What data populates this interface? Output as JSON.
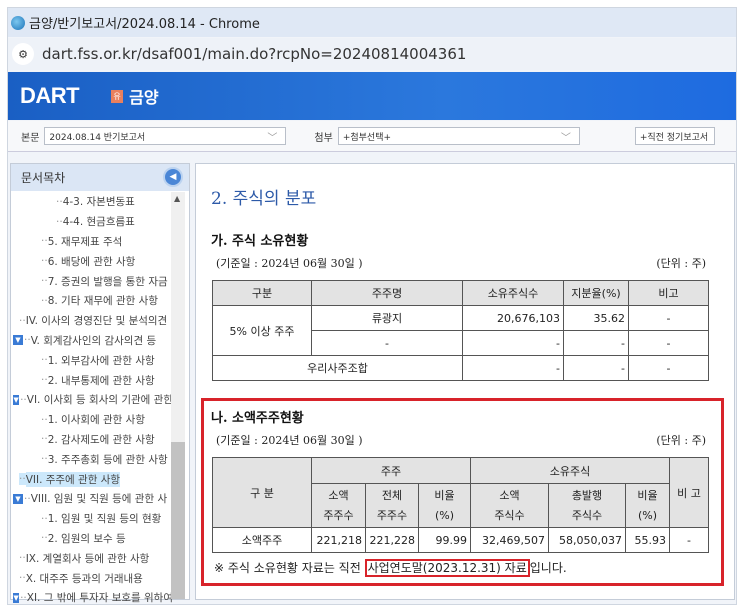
{
  "window": {
    "title": "금양/반기보고서/2024.08.14 - Chrome",
    "url": "dart.fss.or.kr/dsaf001/main.do?rcpNo=20240814004361"
  },
  "header": {
    "brand": "DART",
    "company_badge": "유",
    "company": "금양"
  },
  "selectors": {
    "main_label": "본문",
    "main_value": "2024.08.14  반기보고서",
    "attach_label": "첨부",
    "attach_value": "+첨부선택+",
    "prev_value": "+직전 정기보고서"
  },
  "sidebar": {
    "title": "문서목차",
    "items": [
      {
        "label": "4-3. 자본변동표",
        "indent": 3
      },
      {
        "label": "4-4. 현금흐름표",
        "indent": 3
      },
      {
        "label": "5. 재무제표 주석",
        "indent": 2
      },
      {
        "label": "6. 배당에 관한 사항",
        "indent": 2
      },
      {
        "label": "7. 증권의 발행을 통한 자금",
        "indent": 2
      },
      {
        "label": "8. 기타 재무에 관한 사항",
        "indent": 2
      },
      {
        "label": "IV. 이사의 경영진단 및 분석의견",
        "indent": 1
      },
      {
        "label": "V. 회계감사인의 감사의견 등",
        "indent": 0,
        "expand": true
      },
      {
        "label": "1. 외부감사에 관한 사항",
        "indent": 2
      },
      {
        "label": "2. 내부통제에 관한 사항",
        "indent": 2
      },
      {
        "label": "VI. 이사회 등 회사의 기관에 관한",
        "indent": 0,
        "expand": true
      },
      {
        "label": "1. 이사회에 관한 사항",
        "indent": 2
      },
      {
        "label": "2. 감사제도에 관한 사항",
        "indent": 2
      },
      {
        "label": "3. 주주총회 등에 관한 사항",
        "indent": 2
      },
      {
        "label": "VII. 주주에 관한 사항",
        "indent": 1,
        "selected": true
      },
      {
        "label": "VIII. 임원 및 직원 등에 관한 사",
        "indent": 0,
        "expand": true
      },
      {
        "label": "1. 임원 및 직원 등의 현황",
        "indent": 2
      },
      {
        "label": "2. 임원의 보수 등",
        "indent": 2
      },
      {
        "label": "IX. 계열회사 등에 관한 사항",
        "indent": 1
      },
      {
        "label": "X. 대주주 등과의 거래내용",
        "indent": 1
      },
      {
        "label": "XI. 그 밖에 투자자 보호를 위하여",
        "indent": 0,
        "expand": true
      }
    ]
  },
  "content": {
    "title": "2. 주식의 분포",
    "section_a": {
      "heading": "가. 주식 소유현황",
      "base_date": "(기준일 :     2024년 06월 30일     )",
      "unit": "(단위 : 주)",
      "headers": [
        "구분",
        "주주명",
        "소유주식수",
        "지분율(%)",
        "비고"
      ],
      "group_label": "5% 이상 주주",
      "rows": [
        [
          "류광지",
          "20,676,103",
          "35.62",
          "-"
        ],
        [
          "-",
          "-",
          "-",
          "-"
        ]
      ],
      "esop": [
        "우리사주조합",
        "-",
        "-",
        "-"
      ]
    },
    "section_b": {
      "heading": "나. 소액주주현황",
      "base_date": "(기준일 :     2024년 06월 30일     )",
      "unit": "(단위 : 주)",
      "h_category": "구 분",
      "h_shareholders": "주주",
      "h_shares": "소유주식",
      "h_note": "비 고",
      "sub": [
        "소액\n주주수",
        "전체\n주주수",
        "비율\n(%)",
        "소액\n주식수",
        "총발행\n주식수",
        "비율\n(%)"
      ],
      "row": [
        "소액주주",
        "221,218",
        "221,228",
        "99.99",
        "32,469,507",
        "58,050,037",
        "55.93",
        "-"
      ],
      "footnote_pre": "※ 주식 소유현황 자료는 직전 ",
      "footnote_hl": "사업연도말(2023.12.31) 자료",
      "footnote_post": "입니다."
    }
  },
  "colors": {
    "highlight": "#d8232a",
    "title": "#2d5aa8"
  }
}
